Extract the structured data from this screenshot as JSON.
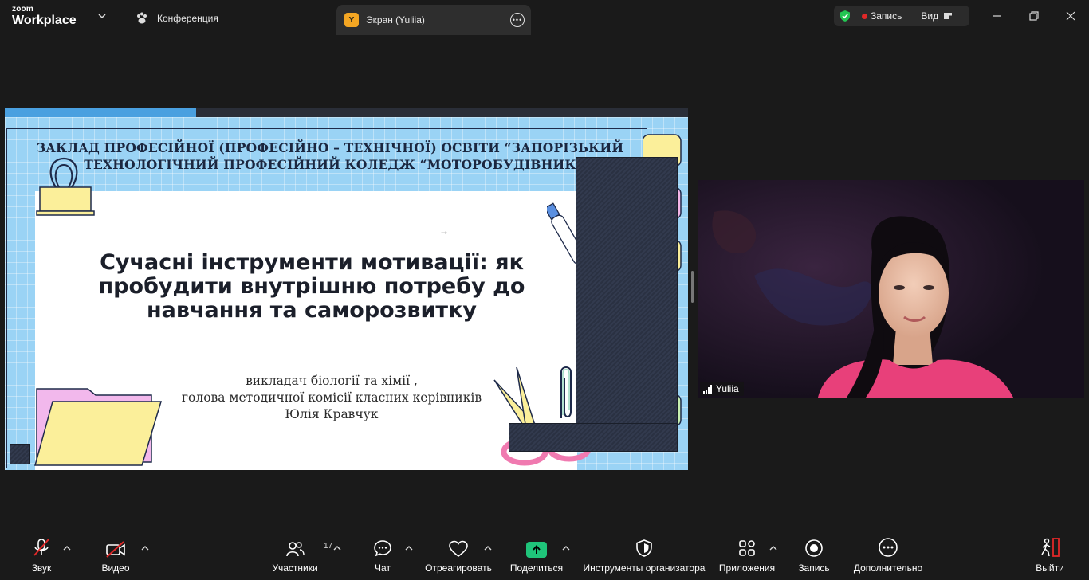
{
  "app": {
    "brand_top": "zoom",
    "brand_bottom": "Workplace"
  },
  "tabs": {
    "conference": "Конференция",
    "screen_avatar": "Y",
    "screen": "Экран (Yuliia)"
  },
  "status": {
    "recording": "Запись",
    "view": "Вид"
  },
  "slide": {
    "header": "ЗАКЛАД ПРОФЕСІЙНОЇ (ПРОФЕСІЙНО – ТЕХНІЧНОЇ) ОСВІТИ “ЗАПОРІЗЬКИЙ ТЕХНОЛОГІЧНИЙ ПРОФЕСІЙНИЙ КОЛЕДЖ “МОТОРОБУДІВНИК",
    "title": "Сучасні інструменти мотивації: як пробудити внутрішню потребу до навчання та саморозвитку",
    "subtitle_line1": "викладач біології та хімії ,",
    "subtitle_line2": "голова методичної комісії класних керівників",
    "subtitle_line3": "Юлія Кравчук"
  },
  "video": {
    "participant_name": "Yuliia"
  },
  "toolbar": {
    "audio": "Звук",
    "video": "Видео",
    "participants": "Участники",
    "participants_count": "17",
    "chat": "Чат",
    "react": "Отреагировать",
    "share": "Поделиться",
    "host_tools": "Инструменты организатора",
    "apps": "Приложения",
    "record": "Запись",
    "more": "Дополнительно",
    "leave": "Выйти"
  },
  "colors": {
    "background": "#1a1a1a",
    "share_green": "#1fc47a",
    "leave_red": "#e02828",
    "shield_green": "#23c552",
    "slide_blue": "#9ad3f5"
  }
}
